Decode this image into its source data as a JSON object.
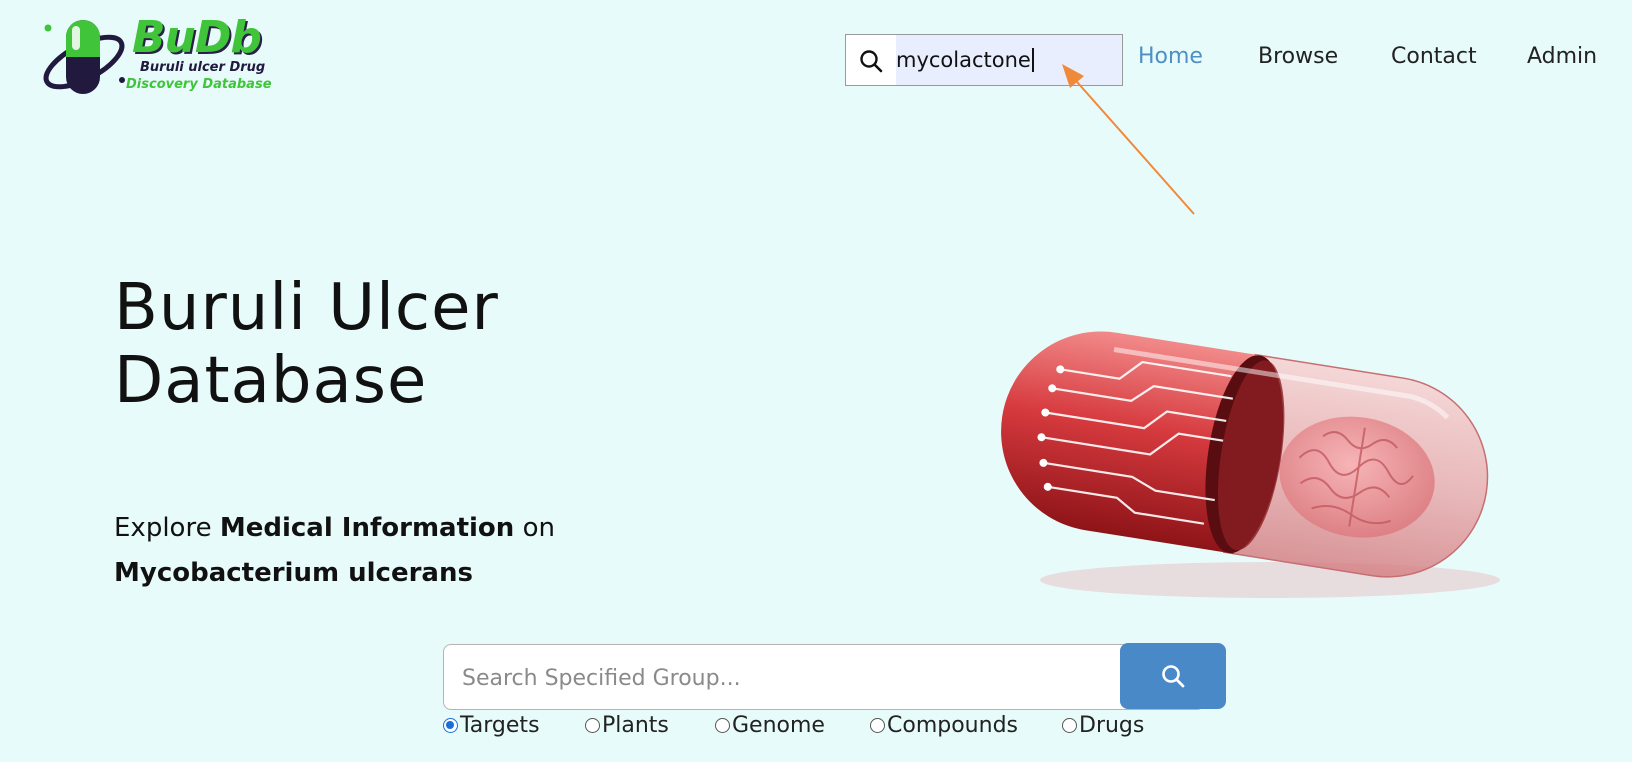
{
  "logo": {
    "word": "BuDb",
    "line1": "Buruli ulcer Drug",
    "line2": "Discovery Database"
  },
  "header": {
    "search": {
      "value": "mycolactone",
      "icon": "search-icon"
    },
    "nav": [
      {
        "label": "Home",
        "active": true
      },
      {
        "label": "Browse",
        "active": false
      },
      {
        "label": "Contact",
        "active": false
      },
      {
        "label": "Admin",
        "active": false
      }
    ]
  },
  "hero": {
    "title_line1": "Buruli Ulcer",
    "title_line2": "Database",
    "sub_plain1": "Explore ",
    "sub_bold1": "Medical Information",
    "sub_plain2": " on",
    "sub_bold2": "Mycobacterium ulcerans"
  },
  "main_search": {
    "placeholder": "Search Specified Group...",
    "button_icon": "search-icon"
  },
  "groups": [
    {
      "label": "Targets",
      "checked": true
    },
    {
      "label": "Plants",
      "checked": false
    },
    {
      "label": "Genome",
      "checked": false
    },
    {
      "label": "Compounds",
      "checked": false
    },
    {
      "label": "Drugs",
      "checked": false
    }
  ],
  "colors": {
    "background": "#e8fbfb",
    "accent": "#4a89c8",
    "nav_active": "#4f8fc4",
    "logo_green": "#3fc43a",
    "annotation": "#f08a3a"
  }
}
